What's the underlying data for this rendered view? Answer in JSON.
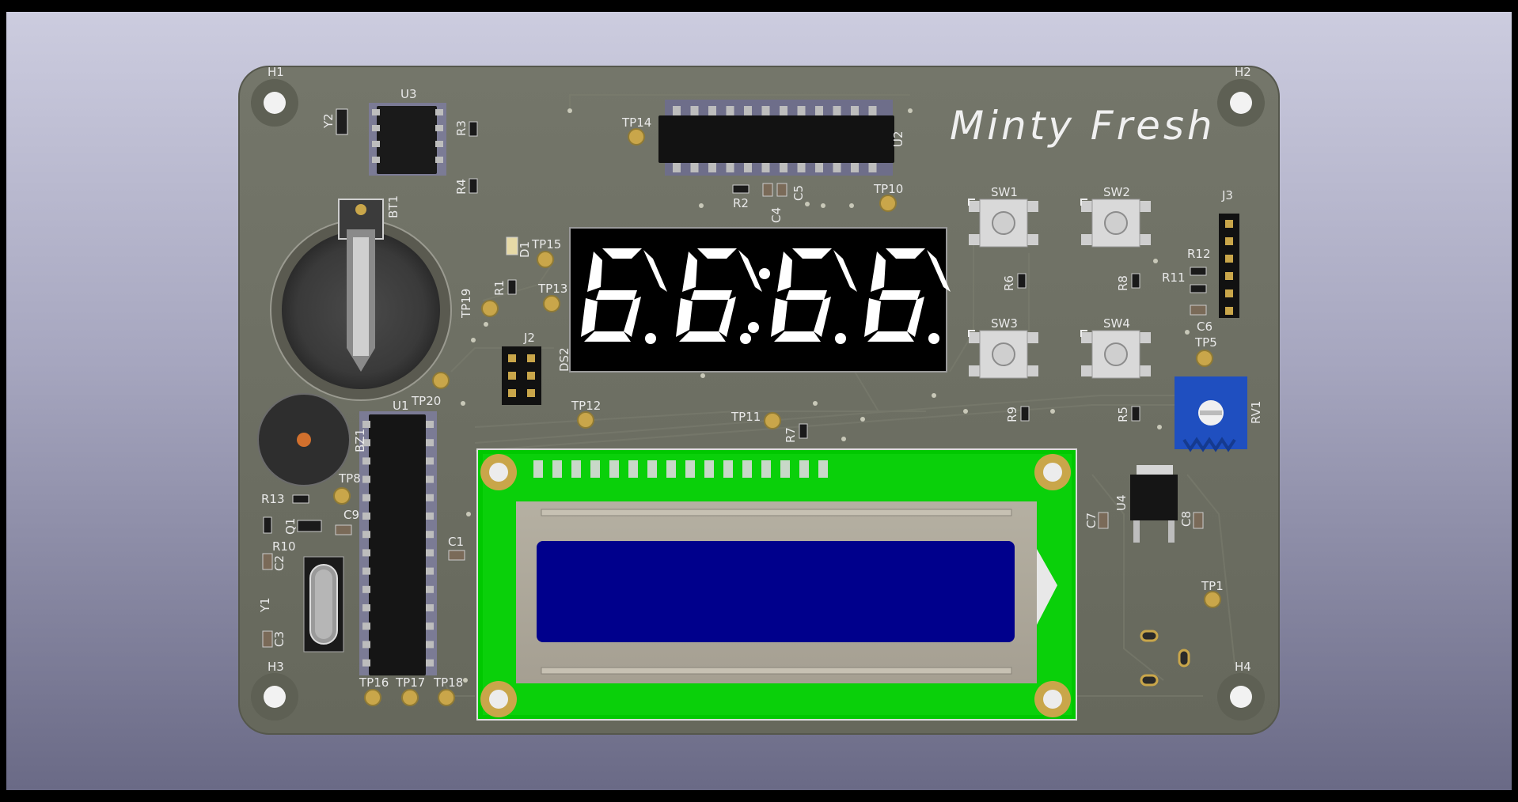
{
  "board": {
    "brand_text": "Minty Fresh",
    "colors": {
      "background_top": "#ccccdf",
      "background_bottom": "#6a6a86",
      "pcb": "#6e7060",
      "silkscreen": "#e9e9e9",
      "pad_gold": "#c9a64a",
      "lcd_pcb": "#00cc00",
      "lcd_screen": "#00008c",
      "potentiometer": "#1f4fc0",
      "seven_segment": "#ffffff"
    },
    "display_digits": "8.8:8.8.",
    "designators": {
      "H1": "H1",
      "H2": "H2",
      "H3": "H3",
      "H4": "H4",
      "U1": "U1",
      "U2": "U2",
      "U3": "U3",
      "U4": "U4",
      "Y1": "Y1",
      "Y2": "Y2",
      "BT1": "BT1",
      "BZ1": "BZ1",
      "DS2": "DS2",
      "D1": "D1",
      "J2": "J2",
      "J3": "J3",
      "RV1": "RV1",
      "Q1": "Q1",
      "R1": "R1",
      "R2": "R2",
      "R3": "R3",
      "R4": "R4",
      "R5": "R5",
      "R6": "R6",
      "R7": "R7",
      "R8": "R8",
      "R9": "R9",
      "R10": "R10",
      "R11": "R11",
      "R12": "R12",
      "R13": "R13",
      "C1": "C1",
      "C2": "C2",
      "C3": "C3",
      "C4": "C4",
      "C5": "C5",
      "C6": "C6",
      "C7": "C7",
      "C8": "C8",
      "C9": "C9",
      "SW1": "SW1",
      "SW2": "SW2",
      "SW3": "SW3",
      "SW4": "SW4",
      "TP1": "TP1",
      "TP5": "TP5",
      "TP8": "TP8",
      "TP10": "TP10",
      "TP11": "TP11",
      "TP12": "TP12",
      "TP13": "TP13",
      "TP14": "TP14",
      "TP15": "TP15",
      "TP16": "TP16",
      "TP17": "TP17",
      "TP18": "TP18",
      "TP19": "TP19",
      "TP20": "TP20"
    }
  }
}
